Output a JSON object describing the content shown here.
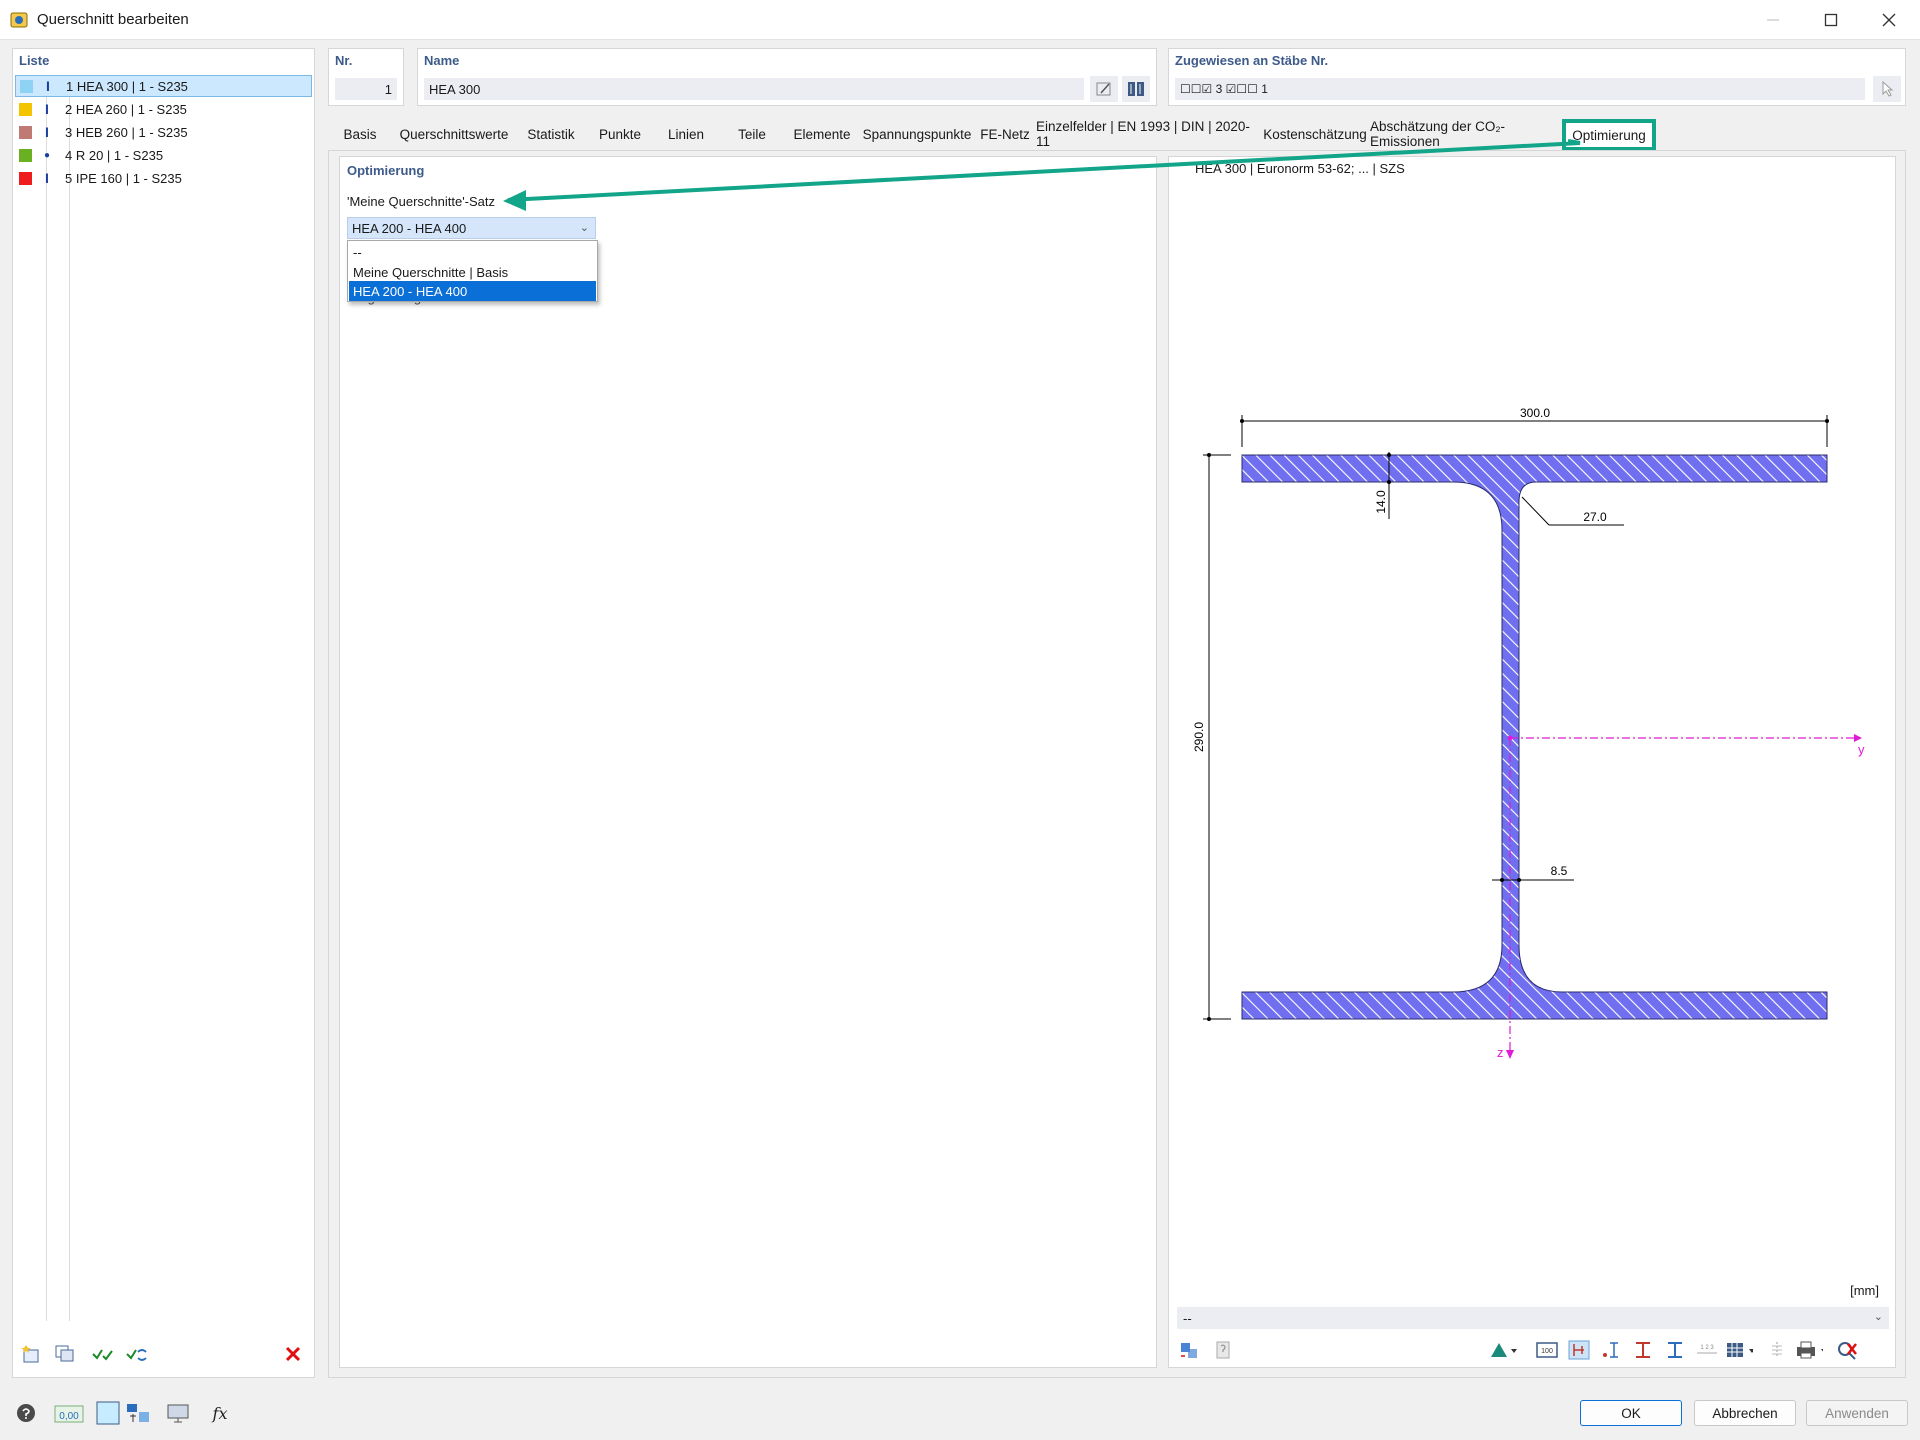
{
  "window": {
    "title": "Querschnitt bearbeiten"
  },
  "list": {
    "label": "Liste",
    "items": [
      {
        "text": "1  HEA 300 | 1 - S235",
        "color": "#8fd3f4",
        "glyph": "I"
      },
      {
        "text": "2  HEA 260 | 1 - S235",
        "color": "#f5c400",
        "glyph": "I"
      },
      {
        "text": "3  HEB 260 | 1 - S235",
        "color": "#c07a74",
        "glyph": "I"
      },
      {
        "text": "4  R 20 | 1 - S235",
        "color": "#6ab023",
        "glyph": "●"
      },
      {
        "text": "5  IPE 160 | 1 - S235",
        "color": "#ee1c1c",
        "glyph": "I"
      }
    ]
  },
  "header": {
    "nr_label": "Nr.",
    "nr_value": "1",
    "name_label": "Name",
    "name_value": "HEA 300",
    "assign_label": "Zugewiesen an Stäbe Nr.",
    "assign_value": "☐☐☑ 3   ☑☐☐ 1"
  },
  "tabs": [
    "Basis",
    "Querschnittswerte",
    "Statistik",
    "Punkte",
    "Linien",
    "Teile",
    "Elemente",
    "Spannungspunkte",
    "FE-Netz",
    "Einzelfelder | EN 1993 | DIN | 2020-11",
    "Kostenschätzung",
    "Abschätzung der CO₂-Emissionen",
    "Optimierung"
  ],
  "optimization": {
    "heading": "Optimierung",
    "set_label": "'Meine Querschnitte'-Satz",
    "selected": "HEA 200 - HEA 400",
    "options": [
      "--",
      "Meine Querschnitte | Basis",
      "HEA 200 - HEA 400"
    ],
    "hidden_text": "Regelmäßig"
  },
  "preview": {
    "caption": "HEA 300 | Euronorm 53-62; ... | SZS",
    "dim_width": "300.0",
    "dim_height": "290.0",
    "dim_flange": "14.0",
    "dim_radius": "27.0",
    "dim_web": "8.5",
    "axis_y": "y",
    "axis_z": "z",
    "unit": "[mm]",
    "select_value": "--"
  },
  "footer": {
    "ok": "OK",
    "cancel": "Abbrechen",
    "apply": "Anwenden"
  },
  "colors": {
    "accent": "#13a58a",
    "section_fill": "#6f6ff0",
    "axis": "#e01ad6"
  }
}
